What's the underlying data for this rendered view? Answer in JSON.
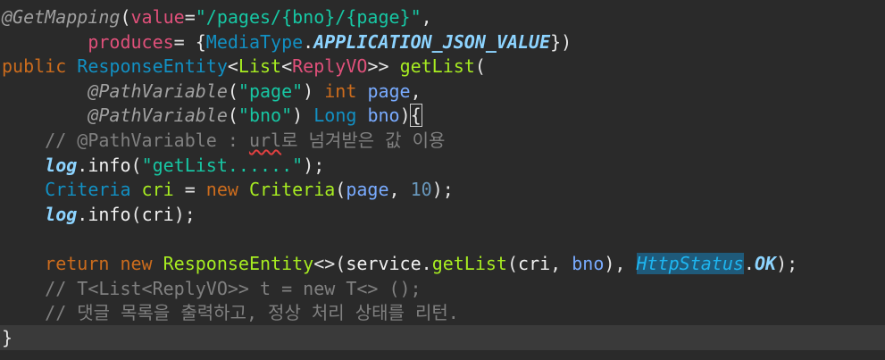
{
  "editor": {
    "lines": [
      [
        {
          "t": "@GetMapping",
          "c": "ann"
        },
        {
          "t": "(",
          "c": "punct"
        },
        {
          "t": "value",
          "c": "attr"
        },
        {
          "t": "=",
          "c": "punct"
        },
        {
          "t": "\"/pages/{bno}/{page}\"",
          "c": "str"
        },
        {
          "t": ",",
          "c": "punct"
        }
      ],
      [
        {
          "t": "        ",
          "c": "punct"
        },
        {
          "t": "produces",
          "c": "attr"
        },
        {
          "t": "= {",
          "c": "punct"
        },
        {
          "t": "MediaType",
          "c": "type"
        },
        {
          "t": ".",
          "c": "punct"
        },
        {
          "t": "APPLICATION_JSON_VALUE",
          "c": "const"
        },
        {
          "t": "})",
          "c": "punct"
        }
      ],
      [
        {
          "t": "public",
          "c": "kw"
        },
        {
          "t": " ",
          "c": "punct"
        },
        {
          "t": "ResponseEntity",
          "c": "type"
        },
        {
          "t": "<",
          "c": "punct"
        },
        {
          "t": "List",
          "c": "method"
        },
        {
          "t": "<",
          "c": "punct"
        },
        {
          "t": "ReplyVO",
          "c": "attr"
        },
        {
          "t": ">> ",
          "c": "punct"
        },
        {
          "t": "getList",
          "c": "method"
        },
        {
          "t": "(",
          "c": "punct"
        }
      ],
      [
        {
          "t": "        ",
          "c": "punct"
        },
        {
          "t": "@PathVariable",
          "c": "ann"
        },
        {
          "t": "(",
          "c": "punct"
        },
        {
          "t": "\"page\"",
          "c": "str"
        },
        {
          "t": ") ",
          "c": "punct"
        },
        {
          "t": "int",
          "c": "kw"
        },
        {
          "t": " ",
          "c": "punct"
        },
        {
          "t": "page",
          "c": "param"
        },
        {
          "t": ",",
          "c": "punct"
        }
      ],
      [
        {
          "t": "        ",
          "c": "punct"
        },
        {
          "t": "@PathVariable",
          "c": "ann"
        },
        {
          "t": "(",
          "c": "punct"
        },
        {
          "t": "\"bno\"",
          "c": "str"
        },
        {
          "t": ") ",
          "c": "punct"
        },
        {
          "t": "Long",
          "c": "type"
        },
        {
          "t": " ",
          "c": "punct"
        },
        {
          "t": "bno",
          "c": "param"
        },
        {
          "t": ")",
          "c": "punct"
        },
        {
          "t": "{",
          "c": "cursor-box punct"
        }
      ],
      [
        {
          "t": "    // @PathVariable : ",
          "c": "comment"
        },
        {
          "t": "url",
          "c": "comment squiggle"
        },
        {
          "t": "로 넘겨받은 값 이용",
          "c": "comment"
        }
      ],
      [
        {
          "t": "    ",
          "c": "punct"
        },
        {
          "t": "log",
          "c": "field"
        },
        {
          "t": ".",
          "c": "punct"
        },
        {
          "t": "info",
          "c": "ident"
        },
        {
          "t": "(",
          "c": "punct"
        },
        {
          "t": "\"getList......\"",
          "c": "str"
        },
        {
          "t": ");",
          "c": "punct"
        }
      ],
      [
        {
          "t": "    ",
          "c": "punct"
        },
        {
          "t": "Criteria",
          "c": "type"
        },
        {
          "t": " ",
          "c": "punct"
        },
        {
          "t": "cri",
          "c": "method"
        },
        {
          "t": " = ",
          "c": "punct"
        },
        {
          "t": "new",
          "c": "kw"
        },
        {
          "t": " ",
          "c": "punct"
        },
        {
          "t": "Criteria",
          "c": "method"
        },
        {
          "t": "(",
          "c": "punct"
        },
        {
          "t": "page",
          "c": "param"
        },
        {
          "t": ", ",
          "c": "punct"
        },
        {
          "t": "10",
          "c": "num"
        },
        {
          "t": ");",
          "c": "punct"
        }
      ],
      [
        {
          "t": "    ",
          "c": "punct"
        },
        {
          "t": "log",
          "c": "field"
        },
        {
          "t": ".",
          "c": "punct"
        },
        {
          "t": "info",
          "c": "ident"
        },
        {
          "t": "(",
          "c": "punct"
        },
        {
          "t": "cri",
          "c": "ident"
        },
        {
          "t": ");",
          "c": "punct"
        }
      ],
      [],
      [
        {
          "t": "    ",
          "c": "punct"
        },
        {
          "t": "return",
          "c": "kw"
        },
        {
          "t": " ",
          "c": "punct"
        },
        {
          "t": "new",
          "c": "kw"
        },
        {
          "t": " ",
          "c": "punct"
        },
        {
          "t": "ResponseEntity",
          "c": "method"
        },
        {
          "t": "<>(",
          "c": "punct"
        },
        {
          "t": "service",
          "c": "ident"
        },
        {
          "t": ".",
          "c": "punct"
        },
        {
          "t": "getList",
          "c": "method"
        },
        {
          "t": "(",
          "c": "punct"
        },
        {
          "t": "cri",
          "c": "ident"
        },
        {
          "t": ", ",
          "c": "punct"
        },
        {
          "t": "bno",
          "c": "param"
        },
        {
          "t": "), ",
          "c": "punct"
        },
        {
          "t": "HttpStatus",
          "c": "sel"
        },
        {
          "t": ".",
          "c": "punct"
        },
        {
          "t": "OK",
          "c": "const"
        },
        {
          "t": ");",
          "c": "punct"
        }
      ],
      [
        {
          "t": "    // T<List<ReplyVO>> t = new T<> ();",
          "c": "comment"
        }
      ],
      [
        {
          "t": "    // 댓글 목록을 출력하고, 정상 처리 상태를 리턴.",
          "c": "comment"
        }
      ],
      [
        {
          "t": "}",
          "c": "punct"
        }
      ]
    ],
    "current_line": 13
  }
}
